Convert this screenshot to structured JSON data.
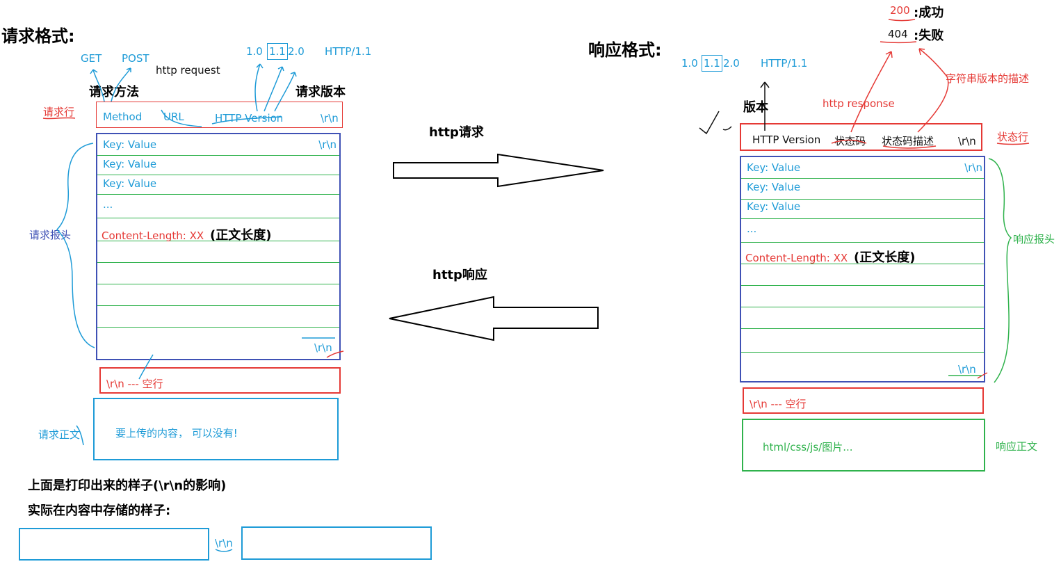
{
  "request": {
    "title": "请求格式:",
    "method_examples": [
      "GET",
      "POST"
    ],
    "http_request_label": "http request",
    "method_note": "请求方法",
    "versions": [
      "1.0",
      "1.1",
      "2.0"
    ],
    "version_example": "HTTP/1.1",
    "version_note": "请求版本",
    "line_label": "请求行",
    "line_fields": [
      "Method",
      "URL",
      "HTTP Version",
      "\\r\\n"
    ],
    "header_label": "请求报头",
    "header_rows": [
      "Key: Value",
      "Key: Value",
      "Key: Value",
      "..."
    ],
    "row_crlf": "\\r\\n",
    "content_length": "Content-Length: XX",
    "content_length_note": "(正文长度)",
    "header_end_crlf": "\\r\\n",
    "blank_line": "\\r\\n --- 空行",
    "body_label": "请求正文",
    "body_text": "要上传的内容， 可以没有!",
    "note1": "上面是打印出来的样子(\\r\\n的影响)",
    "note2": "实际在内容中存储的样子:",
    "storage_sep": "\\r\\n"
  },
  "middle": {
    "http_request": "http请求",
    "http_response": "http响应"
  },
  "response": {
    "title": "响应格式:",
    "versions": [
      "1.0",
      "1.1",
      "2.0"
    ],
    "version_example": "HTTP/1.1",
    "version_note": "版本",
    "http_response_label": "http response",
    "status_codes": [
      {
        "code": "200",
        "meaning": ":成功"
      },
      {
        "code": "404",
        "meaning": ":失败"
      }
    ],
    "desc_note": "字符串版本的描述",
    "line_label": "状态行",
    "line_fields": [
      "HTTP Version",
      "状态码",
      "状态码描述",
      "\\r\\n"
    ],
    "header_label": "响应报头",
    "header_rows": [
      "Key: Value",
      "Key: Value",
      "Key: Value",
      "..."
    ],
    "row_crlf": "\\r\\n",
    "content_length": "Content-Length: XX",
    "content_length_note": "(正文长度)",
    "header_end_crlf": "\\r\\n",
    "blank_line": "\\r\\n --- 空行",
    "body_label": "响应正文",
    "body_text": "html/css/js/图片..."
  },
  "colors": {
    "red": "#e53935",
    "cyan": "#1e9bd7",
    "blue": "#3f51b5",
    "green": "#2fb24c"
  }
}
